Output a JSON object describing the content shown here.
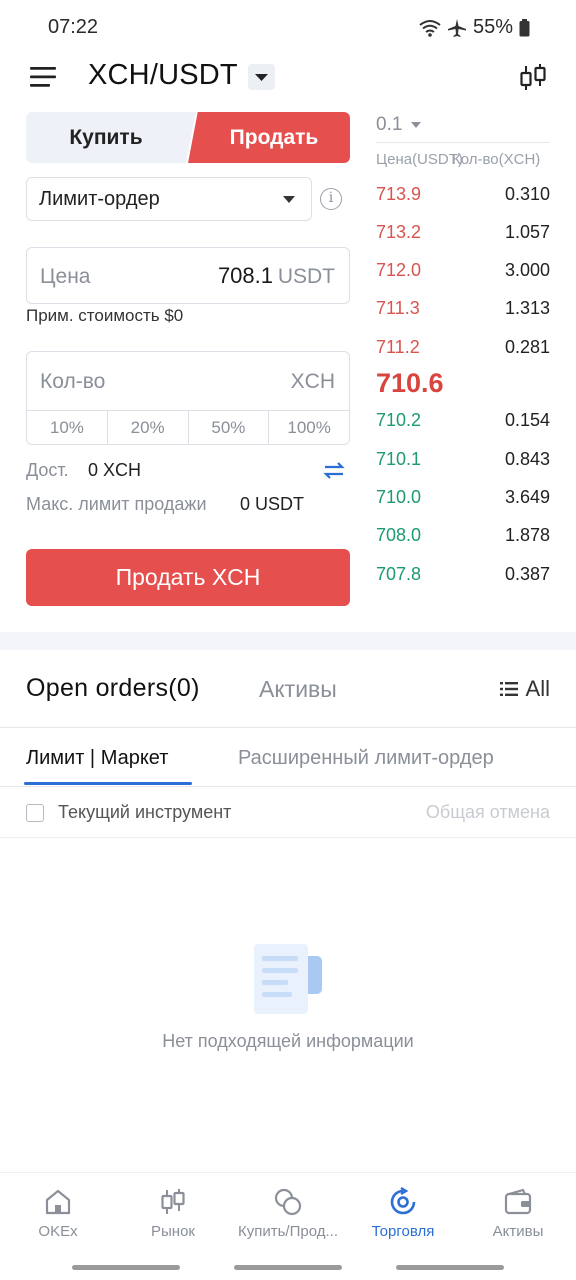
{
  "status_bar": {
    "time": "07:22",
    "battery": "55%"
  },
  "header": {
    "pair": "XCH/USDT"
  },
  "trade_form": {
    "buy_label": "Купить",
    "sell_label": "Продать",
    "order_type": "Лимит-ордер",
    "info_icon": "i",
    "price_placeholder": "Цена",
    "price_value": "708.1",
    "price_unit": "USDT",
    "approx_cost": "Прим. стоимость $0",
    "qty_placeholder": "Кол-во",
    "qty_unit": "XCH",
    "percents": [
      "10%",
      "20%",
      "50%",
      "100%"
    ],
    "available_label": "Дост.",
    "available_value": "0 XCH",
    "max_sell_label": "Макс. лимит продажи",
    "max_sell_value": "0 USDT",
    "submit_label": "Продать XCH"
  },
  "orderbook": {
    "step": "0.1",
    "price_header": "Цена(USDT)",
    "qty_header": "Кол-во(XCH)",
    "asks": [
      {
        "price": "713.9",
        "qty": "0.310"
      },
      {
        "price": "713.2",
        "qty": "1.057"
      },
      {
        "price": "712.0",
        "qty": "3.000"
      },
      {
        "price": "711.3",
        "qty": "1.313"
      },
      {
        "price": "711.2",
        "qty": "0.281"
      }
    ],
    "last_price": "710.6",
    "bids": [
      {
        "price": "710.2",
        "qty": "0.154"
      },
      {
        "price": "710.1",
        "qty": "0.843"
      },
      {
        "price": "710.0",
        "qty": "3.649"
      },
      {
        "price": "708.0",
        "qty": "1.878"
      },
      {
        "price": "707.8",
        "qty": "0.387"
      }
    ],
    "ask_color": "#d9534f",
    "bid_color": "#1c9a73"
  },
  "orders": {
    "tab_open": "Open orders(0)",
    "tab_assets": "Активы",
    "tab_all": "All",
    "sub_limit": "Лимит | Маркет",
    "sub_advanced": "Расширенный лимит-ордер",
    "current_instrument": "Текущий инструмент",
    "cancel_all": "Общая отмена",
    "empty_text": "Нет подходящей информации"
  },
  "bottom_nav": [
    {
      "label": "OKEx",
      "icon": "home-icon"
    },
    {
      "label": "Рынок",
      "icon": "candles-icon"
    },
    {
      "label": "Купить/Прод...",
      "icon": "coins-icon"
    },
    {
      "label": "Торговля",
      "icon": "trade-icon"
    },
    {
      "label": "Активы",
      "icon": "wallet-icon"
    }
  ],
  "colors": {
    "accent": "#2b6ed6",
    "sell": "#e5504f"
  }
}
